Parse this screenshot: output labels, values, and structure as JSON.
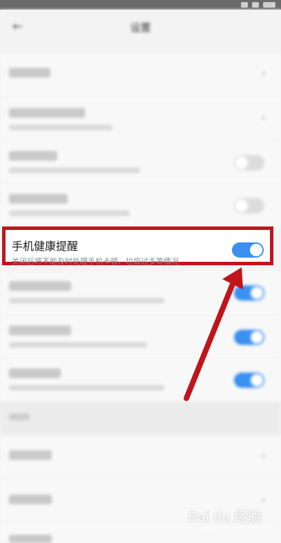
{
  "status_bar": {
    "icons": [
      "signal-icon",
      "wifi-icon",
      "battery-icon"
    ]
  },
  "header": {
    "back_icon": "back-arrow-icon",
    "title": "设置"
  },
  "highlighted_setting": {
    "title": "手机健康提醒",
    "subtitle": "关闭后将不能及时处理手机卡顿、垃圾过多等情况",
    "enabled": true
  },
  "colors": {
    "highlight_border": "#c0141c",
    "toggle_on": "#3a8ff0",
    "arrow": "#c0141c"
  },
  "watermark": {
    "logo": "Bai du 经验",
    "sub": "jingyan.baidu.com"
  }
}
